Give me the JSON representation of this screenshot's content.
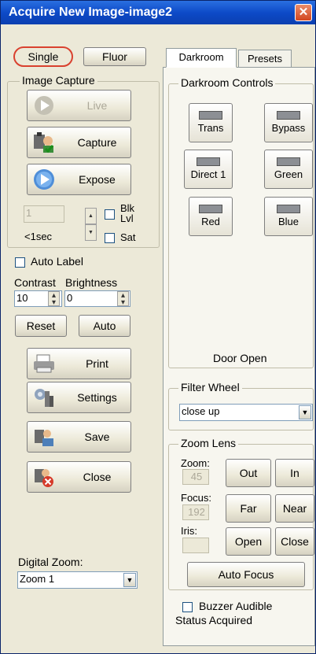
{
  "window": {
    "title": "Acquire New Image-image2",
    "close_symbol": "✕"
  },
  "mode_buttons": {
    "single": "Single",
    "fluor": "Fluor"
  },
  "image_capture": {
    "group_label": "Image Capture",
    "live": "Live",
    "capture": "Capture",
    "expose": "Expose",
    "exposure_value": "1",
    "exposure_text": "<1sec",
    "blk_lvl": "Blk\nLvl",
    "blk": "Blk",
    "lvl": "Lvl",
    "sat": "Sat"
  },
  "auto_label": "Auto Label",
  "contrast": {
    "label": "Contrast",
    "value": "10"
  },
  "brightness": {
    "label": "Brightness",
    "value": "0"
  },
  "reset": "Reset",
  "auto": "Auto",
  "actions": {
    "print": "Print",
    "settings": "Settings",
    "save": "Save",
    "close": "Close"
  },
  "digital_zoom": {
    "label": "Digital Zoom:",
    "value": "Zoom 1"
  },
  "tabs": {
    "darkroom": "Darkroom",
    "presets": "Presets"
  },
  "darkroom": {
    "group_label": "Darkroom Controls",
    "buttons": [
      "Trans",
      "Bypass",
      "Direct 1",
      "Green",
      "Red",
      "Blue"
    ],
    "status": "Door Open"
  },
  "filter_wheel": {
    "label": "Filter Wheel",
    "value": "close up"
  },
  "zoom_lens": {
    "label": "Zoom Lens",
    "zoom_label": "Zoom:",
    "zoom_value": "45",
    "focus_label": "Focus:",
    "focus_value": "192",
    "iris_label": "Iris:",
    "iris_value": "",
    "out": "Out",
    "in": "In",
    "far": "Far",
    "near": "Near",
    "open": "Open",
    "close": "Close",
    "auto_focus": "Auto Focus"
  },
  "buzzer": "Buzzer Audible",
  "status": "Status Acquired"
}
